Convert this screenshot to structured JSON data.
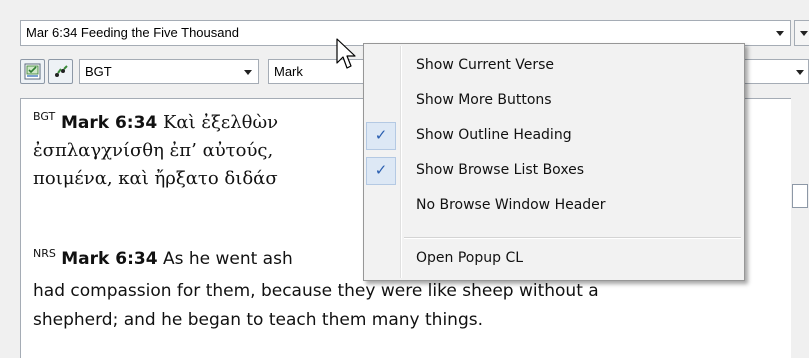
{
  "header": {
    "passage_title": "Mar 6:34 Feeding the Five Thousand"
  },
  "toolbar": {
    "version_select": "BGT",
    "book_select": "Mark"
  },
  "text_pane": {
    "greek": {
      "version": "BGT",
      "reference": "Mark 6:34",
      "lines": [
        "Καὶ ἐξελθὼν",
        "ἐσπλαγχνίσθη ἐπ’ αὐτούς,",
        "ποιμένα, καὶ ἤρξατο διδάσ"
      ]
    },
    "english": {
      "version": "NRS",
      "reference": "Mark 6:34",
      "lines": [
        "As he went ash",
        "had compassion for them, because they were like sheep without a",
        "shepherd; and he began to teach them many things."
      ]
    }
  },
  "context_menu": {
    "items": [
      {
        "label": "Show Current Verse",
        "checked": false
      },
      {
        "label": "Show More Buttons",
        "checked": false
      },
      {
        "label": "Show Outline Heading",
        "checked": true
      },
      {
        "label": "Show Browse List Boxes",
        "checked": true
      },
      {
        "label": "No Browse Window Header",
        "checked": false
      }
    ],
    "footer_item": "Open Popup CL",
    "check_glyph": "✓"
  },
  "colors": {
    "check": "#2b5fb0",
    "menu_bg": "#f2f2f2",
    "check_bg": "#dde8f5"
  },
  "icons": [
    "chevron-down-icon",
    "verse-list-icon",
    "link-verses-icon",
    "mouse-pointer-icon"
  ]
}
